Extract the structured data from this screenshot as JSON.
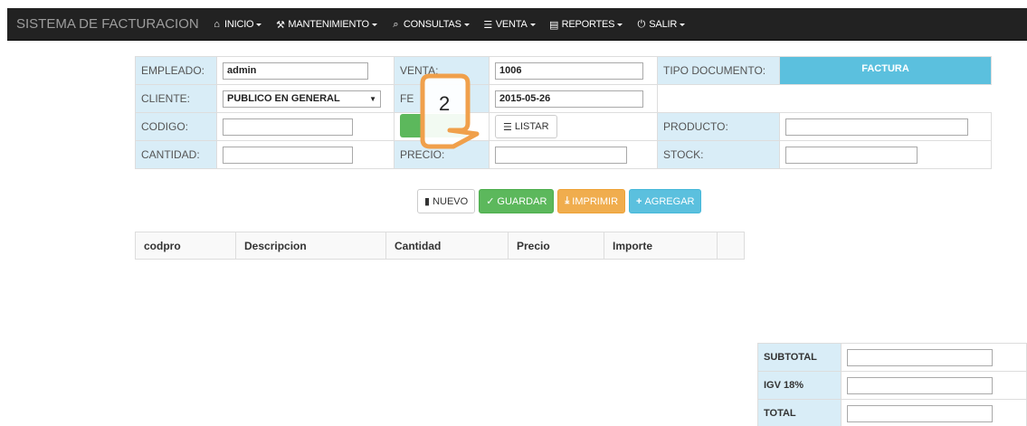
{
  "navbar": {
    "brand": "SISTEMA DE FACTURACION",
    "items": [
      {
        "label": "INICIO",
        "icon": "home-icon",
        "glyph": "⌂"
      },
      {
        "label": "MANTENIMIENTO",
        "icon": "wrench-icon",
        "glyph": "⚒"
      },
      {
        "label": "CONSULTAS",
        "icon": "search-icon",
        "glyph": "⌕"
      },
      {
        "label": "VENTA",
        "icon": "cart-icon",
        "glyph": "☰"
      },
      {
        "label": "REPORTES",
        "icon": "list-alt-icon",
        "glyph": "▤"
      },
      {
        "label": "SALIR",
        "icon": "power-icon",
        "glyph": "⏻"
      }
    ]
  },
  "form": {
    "empleado_label": "EMPLEADO:",
    "empleado_value": "admin",
    "venta_label": "VENTA:",
    "venta_value": "1006",
    "tipo_doc_label": "TIPO DOCUMENTO:",
    "tipo_doc_value": "FACTURA",
    "cliente_label": "CLIENTE:",
    "cliente_value": "PUBLICO EN GENERAL",
    "fecha_label": "FE",
    "fecha_value": "2015-05-26",
    "codigo_label": "CODIGO:",
    "codigo_value": "",
    "listar_label": "LISTAR",
    "producto_label": "PRODUCTO:",
    "producto_value": "",
    "cantidad_label": "CANTIDAD:",
    "cantidad_value": "",
    "precio_label": "PRECIO:",
    "precio_value": "",
    "stock_label": "STOCK:",
    "stock_value": ""
  },
  "actions": {
    "nuevo": "NUEVO",
    "guardar": "GUARDAR",
    "imprimir": "IMPRIMIR",
    "agregar": "AGREGAR"
  },
  "detail_table": {
    "columns": [
      "codpro",
      "Descripcion",
      "Cantidad",
      "Precio",
      "Importe",
      ""
    ]
  },
  "totals": {
    "subtotal_label": "SUBTOTAL",
    "igv_label": "IGV 18%",
    "total_label": "TOTAL"
  },
  "annotation": {
    "number": "2",
    "color": "#f0a04b"
  },
  "colors": {
    "navbar": "#222222",
    "label_bg": "#d9edf7",
    "info": "#5bc0de",
    "success": "#5cb85c",
    "warning": "#f0ad4e"
  }
}
